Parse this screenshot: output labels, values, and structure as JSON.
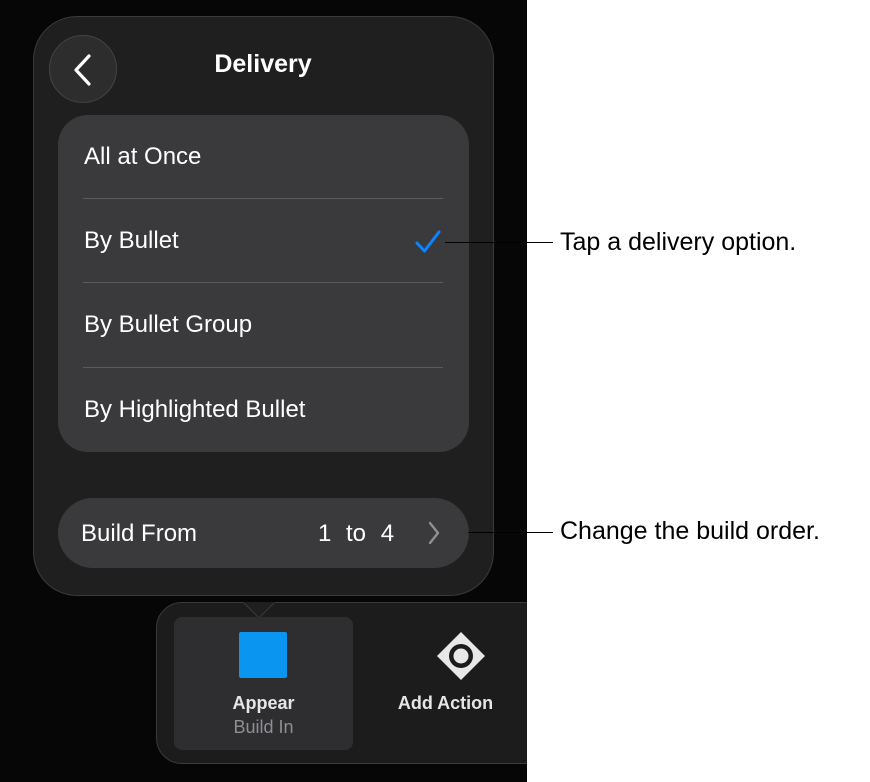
{
  "popover": {
    "title": "Delivery",
    "back_icon": "chevron-left-icon",
    "options": [
      {
        "label": "All at Once",
        "selected": false
      },
      {
        "label": "By Bullet",
        "selected": true
      },
      {
        "label": "By Bullet Group",
        "selected": false
      },
      {
        "label": "By Highlighted Bullet",
        "selected": false
      }
    ],
    "build_from": {
      "label": "Build From",
      "value": "1 to 4"
    }
  },
  "toolbar": {
    "appear": {
      "label": "Appear",
      "sublabel": "Build In"
    },
    "add_action": {
      "label": "Add Action",
      "icon": "diamond-target-icon"
    }
  },
  "callouts": {
    "delivery": "Tap a delivery option.",
    "build_order": "Change the build order."
  },
  "colors": {
    "accent": "#0a84ff",
    "appear_square": "#0a95f0"
  }
}
